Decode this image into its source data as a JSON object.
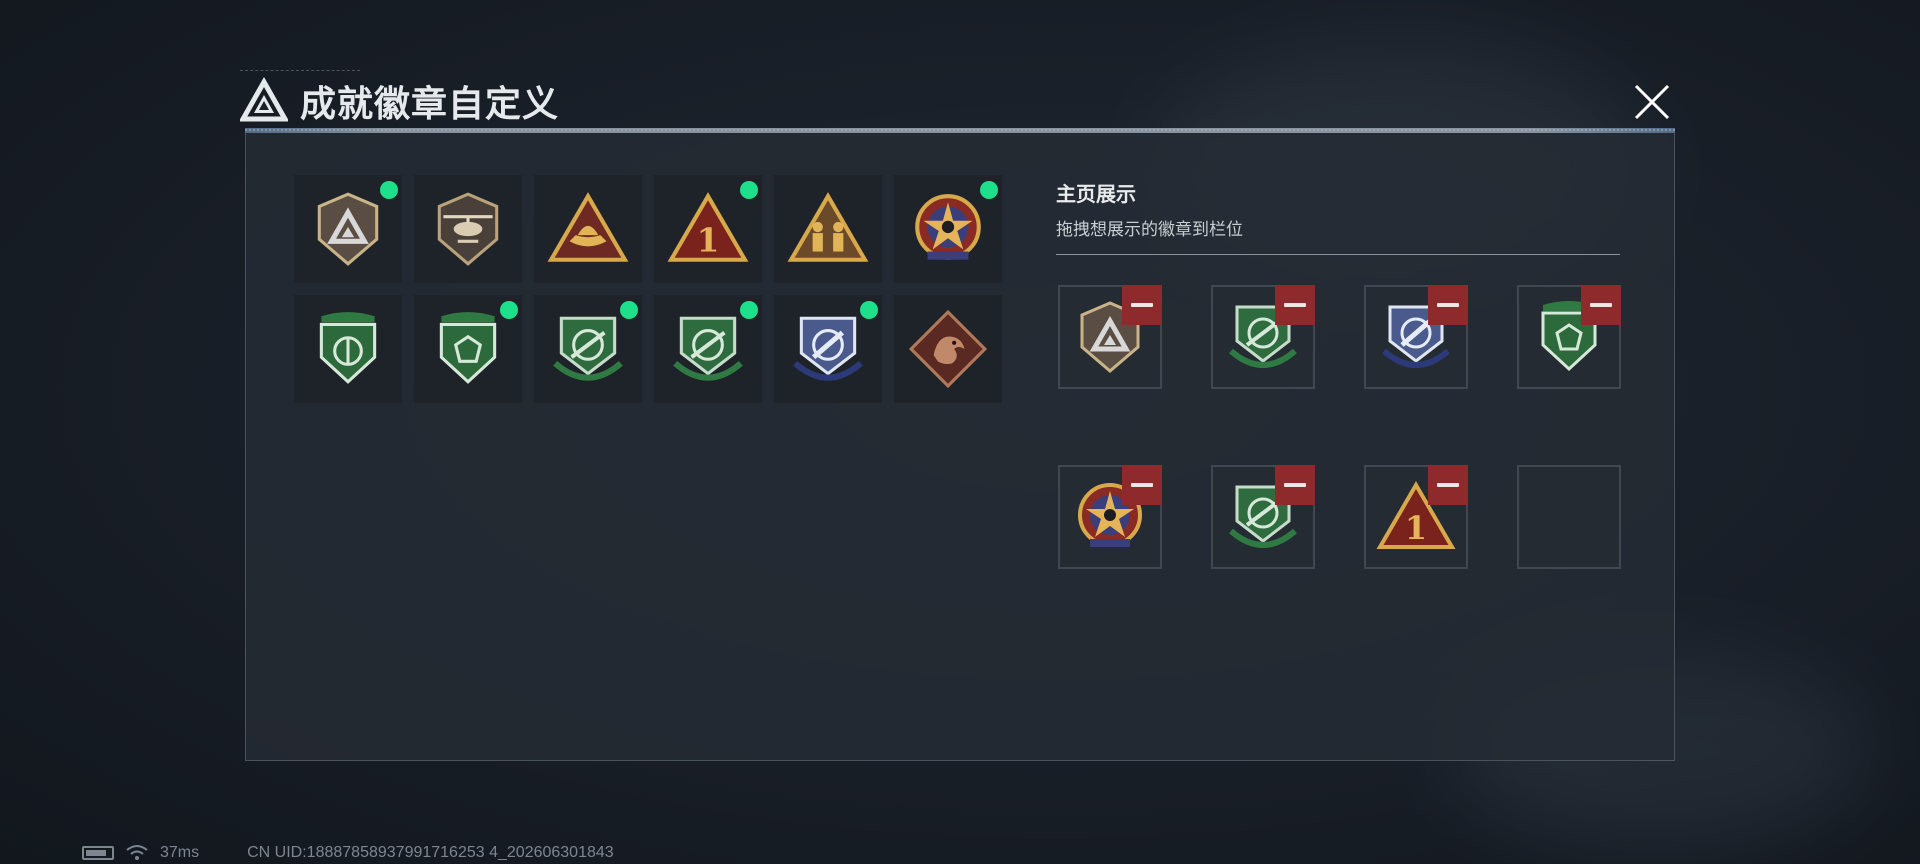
{
  "dialog": {
    "title": "成就徽章自定义"
  },
  "badges": [
    {
      "icon": "triangle-logo-shield-icon",
      "selected": true
    },
    {
      "icon": "helicopter-badge-icon",
      "selected": false
    },
    {
      "icon": "hat-triangle-badge-icon",
      "selected": false
    },
    {
      "icon": "number-one-triangle-badge-icon",
      "selected": true
    },
    {
      "icon": "soldiers-triangle-badge-icon",
      "selected": false
    },
    {
      "icon": "star-emblem-badge-icon",
      "selected": true
    },
    {
      "icon": "green-shield-emblem-badge-icon",
      "selected": false
    },
    {
      "icon": "green-gem-shield-badge-icon",
      "selected": true
    },
    {
      "icon": "green-crosshair-rifle-badge-icon",
      "selected": true
    },
    {
      "icon": "green-crosshair-rifle-badge-2-icon",
      "selected": true
    },
    {
      "icon": "blue-crosshair-knife-badge-icon",
      "selected": true
    },
    {
      "icon": "dragon-diamond-badge-icon",
      "selected": false
    }
  ],
  "showcase": {
    "title": "主页展示",
    "subtitle": "拖拽想展示的徽章到栏位",
    "slots": [
      {
        "icon": "triangle-logo-shield-icon",
        "filled": true
      },
      {
        "icon": "green-crosshair-rifle-badge-icon",
        "filled": true
      },
      {
        "icon": "blue-crosshair-knife-badge-icon",
        "filled": true
      },
      {
        "icon": "green-gem-shield-badge-icon",
        "filled": true
      },
      {
        "icon": "star-emblem-badge-icon",
        "filled": true
      },
      {
        "icon": "green-crosshair-rifle-badge-2-icon",
        "filled": true
      },
      {
        "icon": "number-one-triangle-badge-icon",
        "filled": true
      },
      {
        "icon": "",
        "filled": false
      }
    ]
  },
  "status_bar": {
    "latency": "37ms",
    "uid": "CN UID:18887858937991716253 4_202606301843"
  },
  "colors": {
    "selected_dot": "#1fe08a",
    "remove_button": "#8e2a2c",
    "panel_bg": "#262c34"
  }
}
